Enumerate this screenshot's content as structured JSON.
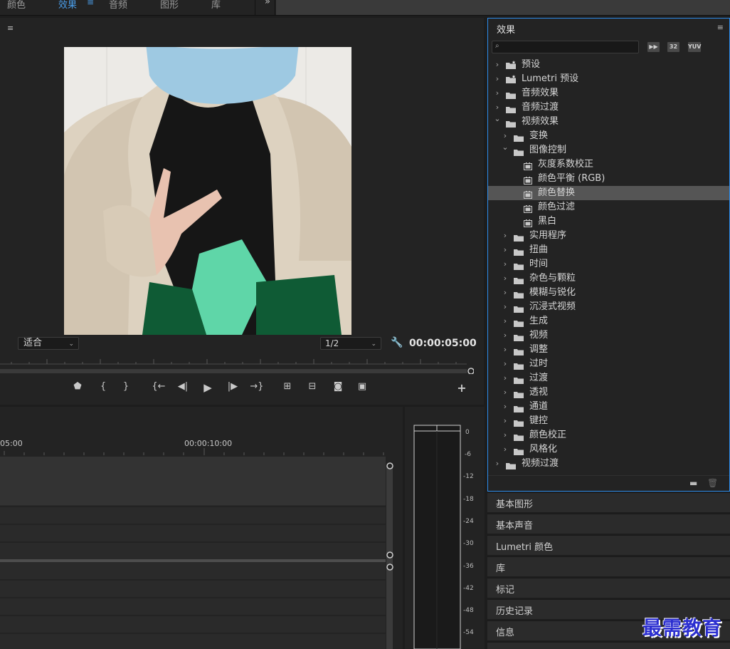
{
  "workspace_tabs": [
    {
      "label": "颜色",
      "active": false
    },
    {
      "label": "效果",
      "active": true
    },
    {
      "label": "音频",
      "active": false
    },
    {
      "label": "图形",
      "active": false
    },
    {
      "label": "库",
      "active": false
    }
  ],
  "workspace_more_icon": "double-chevron-right-icon",
  "colors": {
    "accent": "#2d8ceb",
    "panel_bg": "#232323",
    "selected_row": "#555555",
    "watermark": "#2b2ed0"
  },
  "program_monitor": {
    "menu_icon": "hamburger-icon",
    "fit_select": "适合",
    "resolution_select": "1/2",
    "settings_icon": "wrench-icon",
    "timecode": "00:00:05:00",
    "transport_icons": [
      "add-marker-icon",
      "mark-in-icon",
      "mark-out-icon",
      "go-to-in-icon",
      "step-back-icon",
      "play-icon",
      "step-forward-icon",
      "go-to-out-icon",
      "lift-icon",
      "extract-icon",
      "export-frame-icon",
      "compare-view-icon",
      "add-button-icon"
    ]
  },
  "timeline": {
    "time_left": "05:00",
    "time_right": "00:00:10:00"
  },
  "audio_meter": {
    "scale": [
      "0",
      "-6",
      "-12",
      "-18",
      "-24",
      "-30",
      "-36",
      "-42",
      "-48",
      "-54"
    ]
  },
  "effects_panel": {
    "title": "效果",
    "search_value": "",
    "filter_badges": [
      "accelerated-effects-icon",
      "32",
      "YUV"
    ],
    "tree": [
      {
        "label": "预设",
        "depth": 0,
        "kind": "preset-folder",
        "expanded": false
      },
      {
        "label": "Lumetri 预设",
        "depth": 0,
        "kind": "preset-folder",
        "expanded": false
      },
      {
        "label": "音频效果",
        "depth": 0,
        "kind": "folder",
        "expanded": false
      },
      {
        "label": "音频过渡",
        "depth": 0,
        "kind": "folder",
        "expanded": false
      },
      {
        "label": "视频效果",
        "depth": 0,
        "kind": "folder",
        "expanded": true
      },
      {
        "label": "变换",
        "depth": 1,
        "kind": "folder",
        "expanded": false
      },
      {
        "label": "图像控制",
        "depth": 1,
        "kind": "folder",
        "expanded": true
      },
      {
        "label": "灰度系数校正",
        "depth": 2,
        "kind": "effect"
      },
      {
        "label": "颜色平衡 (RGB)",
        "depth": 2,
        "kind": "effect"
      },
      {
        "label": "颜色替换",
        "depth": 2,
        "kind": "effect",
        "selected": true
      },
      {
        "label": "颜色过滤",
        "depth": 2,
        "kind": "effect"
      },
      {
        "label": "黑白",
        "depth": 2,
        "kind": "effect"
      },
      {
        "label": "实用程序",
        "depth": 1,
        "kind": "folder",
        "expanded": false
      },
      {
        "label": "扭曲",
        "depth": 1,
        "kind": "folder",
        "expanded": false
      },
      {
        "label": "时间",
        "depth": 1,
        "kind": "folder",
        "expanded": false
      },
      {
        "label": "杂色与颗粒",
        "depth": 1,
        "kind": "folder",
        "expanded": false
      },
      {
        "label": "模糊与锐化",
        "depth": 1,
        "kind": "folder",
        "expanded": false
      },
      {
        "label": "沉浸式视频",
        "depth": 1,
        "kind": "folder",
        "expanded": false
      },
      {
        "label": "生成",
        "depth": 1,
        "kind": "folder",
        "expanded": false
      },
      {
        "label": "视频",
        "depth": 1,
        "kind": "folder",
        "expanded": false
      },
      {
        "label": "调整",
        "depth": 1,
        "kind": "folder",
        "expanded": false
      },
      {
        "label": "过时",
        "depth": 1,
        "kind": "folder",
        "expanded": false
      },
      {
        "label": "过渡",
        "depth": 1,
        "kind": "folder",
        "expanded": false
      },
      {
        "label": "透视",
        "depth": 1,
        "kind": "folder",
        "expanded": false
      },
      {
        "label": "通道",
        "depth": 1,
        "kind": "folder",
        "expanded": false
      },
      {
        "label": "键控",
        "depth": 1,
        "kind": "folder",
        "expanded": false
      },
      {
        "label": "颜色校正",
        "depth": 1,
        "kind": "folder",
        "expanded": false
      },
      {
        "label": "风格化",
        "depth": 1,
        "kind": "folder",
        "expanded": false
      },
      {
        "label": "视频过渡",
        "depth": 0,
        "kind": "folder",
        "expanded": false
      }
    ]
  },
  "side_panels": [
    "基本图形",
    "基本声音",
    "Lumetri 颜色",
    "库",
    "标记",
    "历史记录",
    "信息"
  ],
  "watermark": "最需教育"
}
